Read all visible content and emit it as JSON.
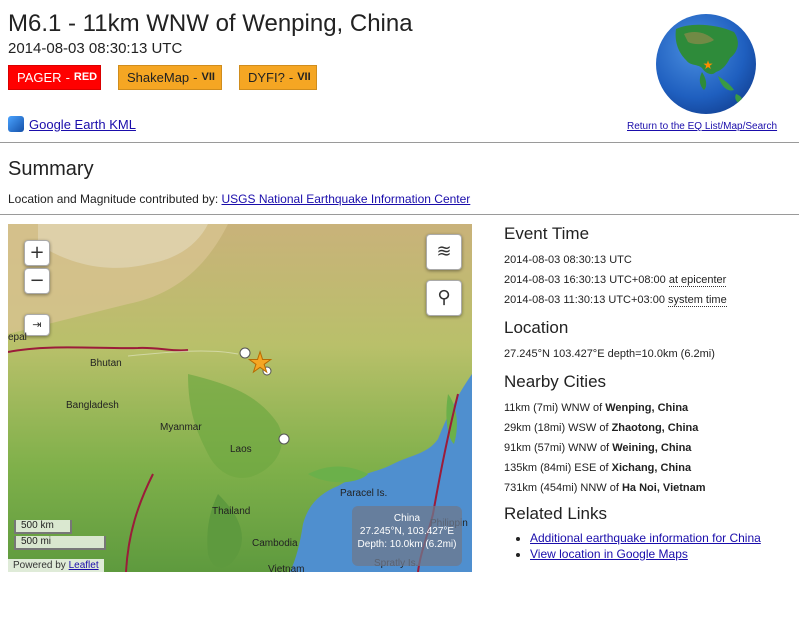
{
  "header": {
    "title": "M6.1 - 11km WNW of Wenping, China",
    "datetime": "2014-08-03 08:30:13 UTC"
  },
  "badges": [
    {
      "label": "PAGER",
      "level": "RED",
      "color": "#ff0000"
    },
    {
      "label": "ShakeMap",
      "level": "VII",
      "color": "#f5a623"
    },
    {
      "label": "DYFI?",
      "level": "VII",
      "color": "#f5a623"
    }
  ],
  "links": {
    "kml": "Google Earth KML",
    "return": "Return to the EQ List/Map/Search"
  },
  "summary": {
    "heading": "Summary",
    "contrib_prefix": "Location and Magnitude contributed by:",
    "contrib_link": "USGS National Earthquake Information Center"
  },
  "map": {
    "zoom_in": "+",
    "zoom_out": "−",
    "scale_km": "500 km",
    "scale_mi": "500 mi",
    "powered_by": "Powered by",
    "leaflet": "Leaflet",
    "labels": {
      "nepal": "epal",
      "bhutan": "Bhutan",
      "bangladesh": "Bangladesh",
      "myanmar": "Myanmar",
      "laos": "Laos",
      "thailand": "Thailand",
      "cambodia": "Cambodia",
      "vietnam": "Vietnam",
      "paracel": "Paracel Is.",
      "spratly": "Spratly Is.",
      "philippines": "Philippin"
    },
    "info": {
      "country": "China",
      "coords": "27.245°N, 103.427°E",
      "depth": "Depth: 10.0km (6.2mi)"
    }
  },
  "event_time": {
    "heading": "Event Time",
    "utc": "2014-08-03 08:30:13 UTC",
    "epicenter_time": "2014-08-03 16:30:13 UTC+08:00",
    "epicenter_suffix": "at epicenter",
    "system_time": "2014-08-03 11:30:13 UTC+03:00",
    "system_suffix": "system time"
  },
  "location": {
    "heading": "Location",
    "value": "27.245°N 103.427°E depth=10.0km (6.2mi)"
  },
  "nearby": {
    "heading": "Nearby Cities",
    "cities": [
      {
        "dist": "11km (7mi) WNW of",
        "name": "Wenping, China"
      },
      {
        "dist": "29km (18mi) WSW of",
        "name": "Zhaotong, China"
      },
      {
        "dist": "91km (57mi) WNW of",
        "name": "Weining, China"
      },
      {
        "dist": "135km (84mi) ESE of",
        "name": "Xichang, China"
      },
      {
        "dist": "731km (454mi) NNW of",
        "name": "Ha Noi, Vietnam"
      }
    ]
  },
  "related": {
    "heading": "Related Links",
    "items": [
      "Additional earthquake information for China",
      "View location in Google Maps"
    ]
  }
}
